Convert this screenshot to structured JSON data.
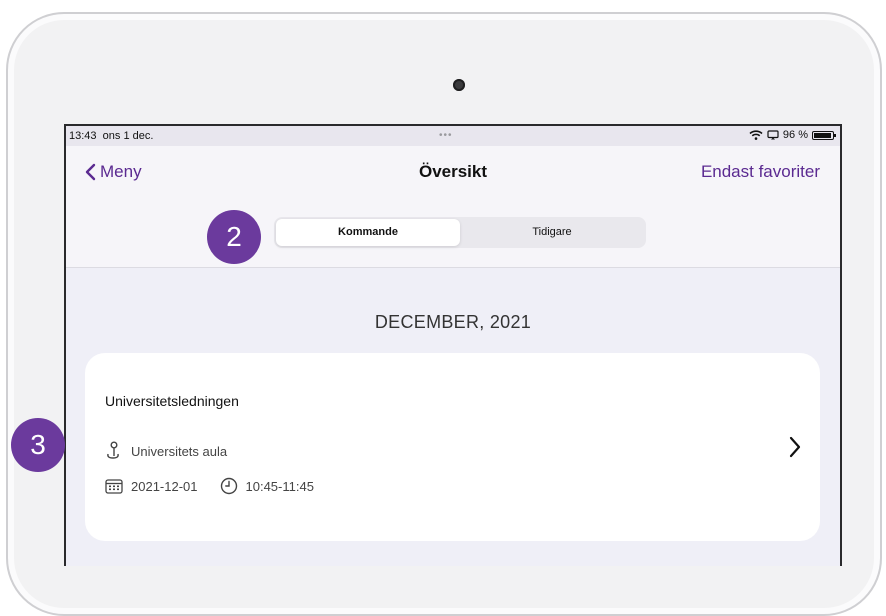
{
  "status_bar": {
    "time": "13:43",
    "date": "ons 1 dec.",
    "dots": "•••",
    "battery": "96 %"
  },
  "nav": {
    "back_label": "Meny",
    "title": "Översikt",
    "right_label": "Endast favoriter"
  },
  "segmented": {
    "options": [
      "Kommande",
      "Tidigare"
    ],
    "selected": "Kommande"
  },
  "section": {
    "title": "DECEMBER, 2021"
  },
  "events": [
    {
      "title": "Universitetsledningen",
      "location": "Universitets aula",
      "date": "2021-12-01",
      "time": "10:45-11:45"
    }
  ],
  "callouts": [
    "2",
    "3"
  ],
  "colors": {
    "accent": "#5b2a91",
    "badge": "#6b3a9d",
    "background": "#efeff7"
  }
}
